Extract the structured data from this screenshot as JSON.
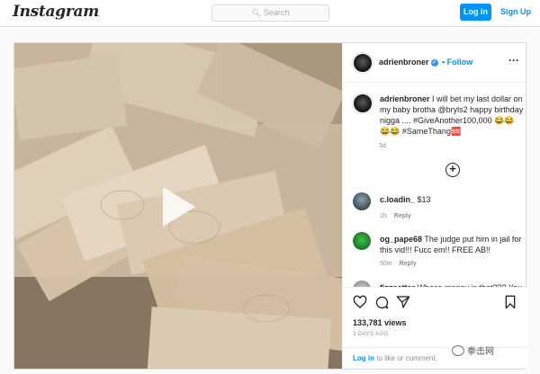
{
  "nav": {
    "logo": "Instagram",
    "search_placeholder": "Search",
    "login_label": "Log In",
    "signup_label": "Sign Up"
  },
  "post": {
    "username": "adrienbroner",
    "follow_label": "• Follow",
    "caption": {
      "username": "adrienbroner",
      "text": "I will bet my last dollar on my baby brotha @bryls2 happy birthday nigga .... #GiveAnother100,000 😂😂😂😂 #SameThang🆘",
      "time": "3d"
    },
    "comments": [
      {
        "username": "c.loadin_",
        "text": "$13",
        "time": "1h",
        "reply": "Reply"
      },
      {
        "username": "og_pape68",
        "text": "The judge put him in jail for this vid!!! Fucc em!! FREE AB!!",
        "time": "50m",
        "reply": "Reply"
      },
      {
        "username": "fizzsattar",
        "text": "Whose money is that??? You",
        "time": "",
        "reply": ""
      }
    ],
    "views": "133,781 views",
    "date": "3 DAYS AGO",
    "login_prompt_link": "Log in",
    "login_prompt_rest": "to like or comment."
  },
  "watermark": "拳击网",
  "colors": {
    "accent": "#0095f6",
    "border": "#dbdbdb"
  }
}
